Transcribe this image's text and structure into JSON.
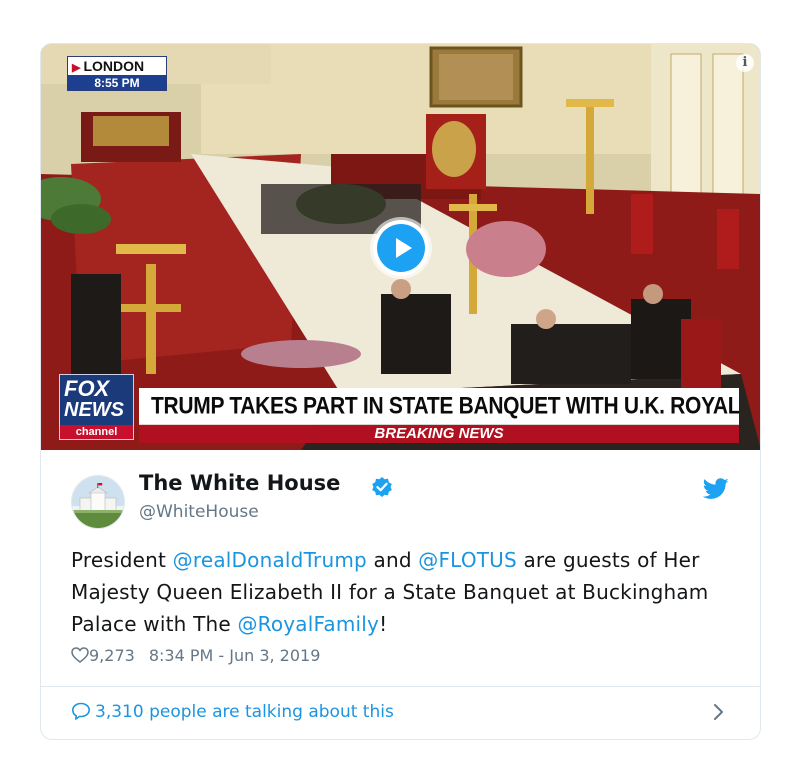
{
  "video": {
    "location_label": "LONDON",
    "time_label": "8:55 PM",
    "network_logo": {
      "line1": "FOX",
      "line2": "NEWS",
      "line3": "channel"
    },
    "headline": "TRUMP TAKES PART IN STATE BANQUET WITH U.K. ROYALS",
    "ticker": "BREAKING NEWS",
    "info_icon_glyph": "i",
    "play_icon": "play-icon"
  },
  "tweet": {
    "author_name": "The White House",
    "handle": "@WhiteHouse",
    "verified_icon": "verified-badge-icon",
    "platform_icon": "twitter-bird-icon",
    "text": {
      "t1": "President ",
      "m1": "@realDonaldTrump",
      "t2": " and ",
      "m2": "@FLOTUS",
      "t3": " are guests of Her Majesty Queen Elizabeth II for a State Banquet at Buckingham Palace with The ",
      "m3": "@RoyalFamily",
      "t4": "!"
    },
    "likes": "9,273",
    "timestamp": "8:34 PM - Jun 3, 2019",
    "talking": "3,310 people are talking about this"
  },
  "colors": {
    "link_blue": "#1b95e0",
    "twitter_blue": "#1da1f2",
    "fox_red": "#c8102e",
    "fox_navy": "#1b3a7a",
    "muted_text": "#657786",
    "border": "#e1e8ed"
  }
}
